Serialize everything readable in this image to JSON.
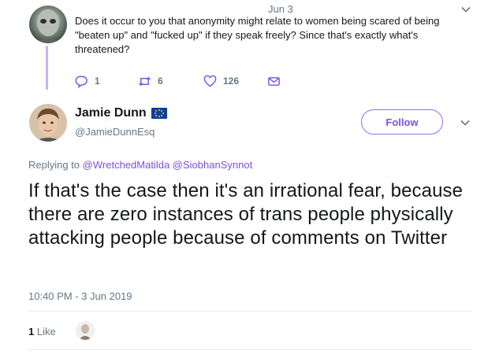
{
  "parent_tweet": {
    "date": "Jun 3",
    "text": "Does it occur to you that anonymity might relate to women being scared of being \"beaten up\" and \"fucked up\" if they speak freely? Since that's exactly what's threatened?",
    "reply_count": "1",
    "retweet_count": "6",
    "like_count": "126"
  },
  "main_tweet": {
    "display_name": "Jamie Dunn",
    "handle": "@JamieDunnEsq",
    "follow_label": "Follow",
    "replying_prefix": "Replying to",
    "replying_to": [
      "@WretchedMatilda",
      "@SiobhanSynnot"
    ],
    "text": "If that's the case then it's an irrational fear, because there are zero instances of trans people physically attacking people because of comments on Twitter",
    "timestamp": "10:40 PM - 3 Jun 2019",
    "like_count": "1",
    "like_label": "Like"
  },
  "colors": {
    "accent": "#7b4ee8",
    "thread_line": "#c7b3f5",
    "muted": "#657786"
  }
}
